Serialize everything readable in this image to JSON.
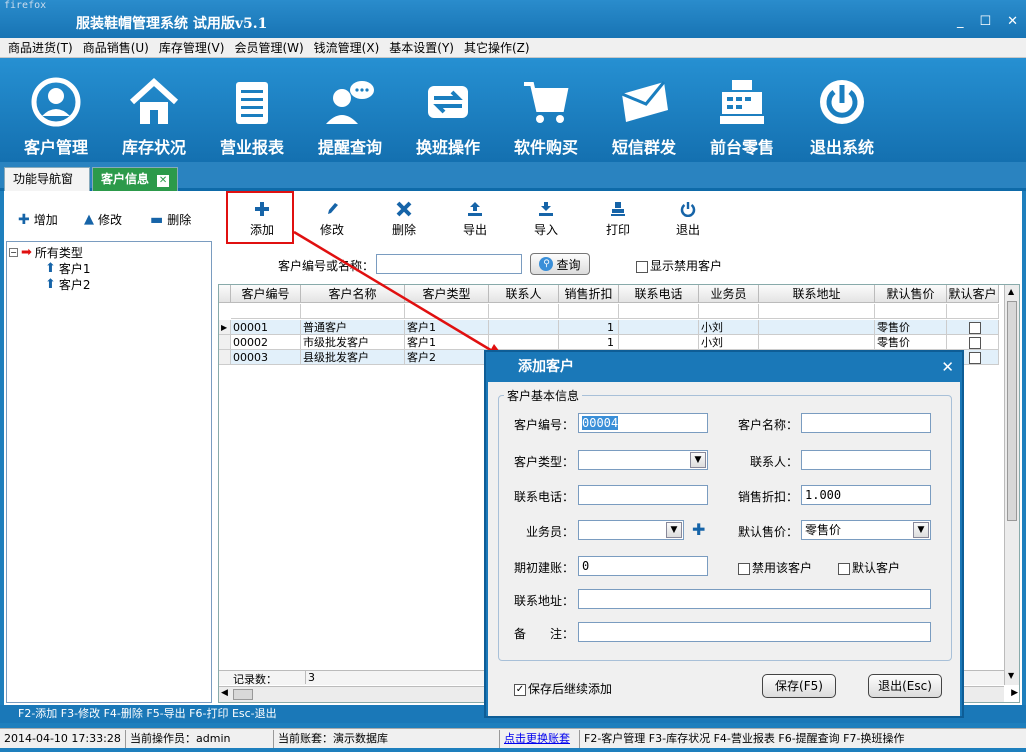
{
  "window": {
    "browser_label": "firefox",
    "title": "服装鞋帽管理系统 试用版v5.1"
  },
  "menu": [
    "商品进货(T)",
    "商品销售(U)",
    "库存管理(V)",
    "会员管理(W)",
    "钱流管理(X)",
    "基本设置(Y)",
    "其它操作(Z)"
  ],
  "big_toolbar": [
    {
      "label": "客户管理",
      "icon": "user-circle-icon"
    },
    {
      "label": "库存状况",
      "icon": "house-icon"
    },
    {
      "label": "营业报表",
      "icon": "report-icon"
    },
    {
      "label": "提醒查询",
      "icon": "chat-person-icon"
    },
    {
      "label": "换班操作",
      "icon": "swap-arrows-icon"
    },
    {
      "label": "软件购买",
      "icon": "cart-icon"
    },
    {
      "label": "短信群发",
      "icon": "envelope-icon"
    },
    {
      "label": "前台零售",
      "icon": "cash-register-icon"
    },
    {
      "label": "退出系统",
      "icon": "power-icon"
    }
  ],
  "tabs": {
    "nav": "功能导航窗口",
    "active": "客户信息"
  },
  "left_toolbar": {
    "add": "增加",
    "edit": "修改",
    "delete": "删除"
  },
  "tree": {
    "root": "所有类型",
    "children": [
      "客户1",
      "客户2"
    ]
  },
  "right_toolbar": [
    {
      "label": "添加",
      "icon": "plus-icon"
    },
    {
      "label": "修改",
      "icon": "pencil-icon"
    },
    {
      "label": "删除",
      "icon": "x-icon"
    },
    {
      "label": "导出",
      "icon": "export-icon"
    },
    {
      "label": "导入",
      "icon": "import-icon"
    },
    {
      "label": "打印",
      "icon": "printer-icon"
    },
    {
      "label": "退出",
      "icon": "power-small-icon"
    }
  ],
  "search": {
    "label": "客户编号或名称：",
    "value": "",
    "button": "查询",
    "show_disabled": "显示禁用客户"
  },
  "grid": {
    "columns": [
      "客户编号",
      "客户名称",
      "客户类型",
      "联系人",
      "销售折扣",
      "联系电话",
      "业务员",
      "联系地址",
      "默认售价",
      "默认客户"
    ],
    "rows": [
      [
        "00001",
        "普通客户",
        "客户1",
        "",
        "1",
        "",
        "小刘",
        "",
        "零售价",
        ""
      ],
      [
        "00002",
        "市级批发客户",
        "客户1",
        "",
        "1",
        "",
        "小刘",
        "",
        "零售价",
        ""
      ],
      [
        "00003",
        "县级批发客户",
        "客户2",
        "",
        "",
        "",
        "",
        "",
        "",
        ""
      ]
    ],
    "footer_label": "记录数：",
    "footer_count": "3"
  },
  "fkeys": "F2-添加 F3-修改 F4-删除 F5-导出 F6-打印 Esc-退出",
  "status": {
    "datetime": "2014-04-10 17:33:28",
    "operator": "当前操作员：admin",
    "account": "当前账套：演示数据库",
    "switch_link": "点击更换账套",
    "hotkeys": "F2-客户管理 F3-库存状况 F4-营业报表 F6-提醒查询 F7-换班操作"
  },
  "dialog": {
    "title": "添加客户",
    "group": "客户基本信息",
    "labels": {
      "code": "客户编号：",
      "name": "客户名称：",
      "type": "客户类型：",
      "contact": "联系人：",
      "phone": "联系电话：",
      "discount": "销售折扣：",
      "salesman": "业务员：",
      "default_price": "默认售价：",
      "opening": "期初建账：",
      "disable": "禁用该客户",
      "default_customer": "默认客户",
      "address": "联系地址：",
      "note": "备　　注："
    },
    "values": {
      "code": "00004",
      "name": "",
      "type": "",
      "contact": "",
      "phone": "",
      "discount": "1.000",
      "salesman": "",
      "default_price": "零售价",
      "opening": "0",
      "address": "",
      "note": ""
    },
    "continue_label": "保存后继续添加",
    "save": "保存(F5)",
    "exit": "退出(Esc)"
  }
}
